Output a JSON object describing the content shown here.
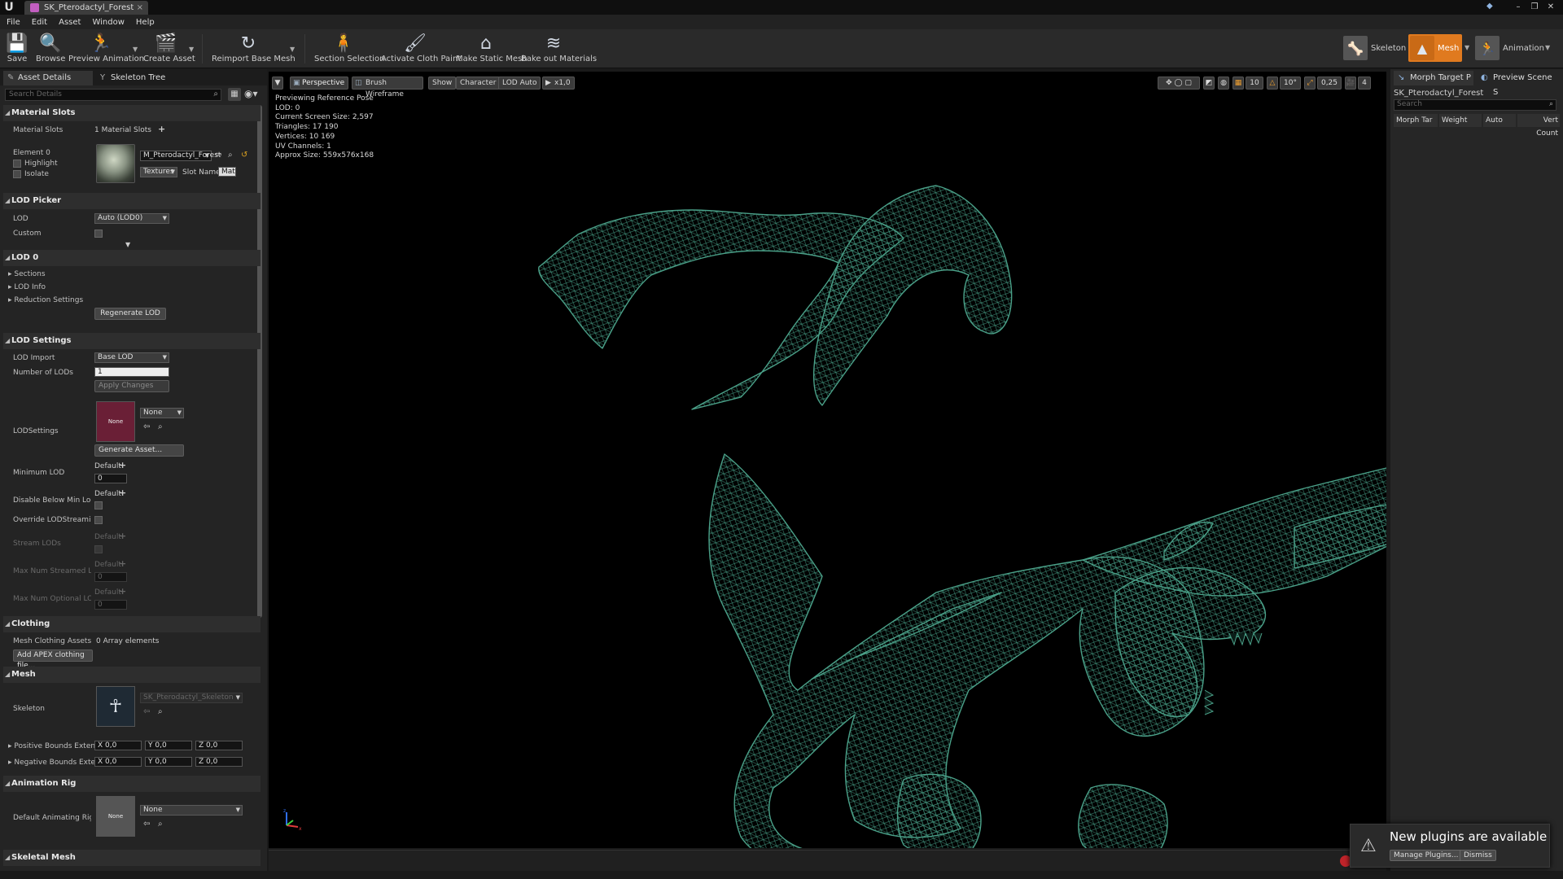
{
  "window": {
    "tab_title": "SK_Pterodactyl_Forest",
    "tab_close": "×",
    "logo": "U",
    "minimize": "–",
    "restore": "❐",
    "close": "✕"
  },
  "menu": [
    "File",
    "Edit",
    "Asset",
    "Window",
    "Help"
  ],
  "toolbar": {
    "save": "Save",
    "browse": "Browse",
    "preview_animation": "Preview Animation",
    "create_asset": "Create Asset",
    "reimport": "Reimport Base Mesh",
    "section_selection": "Section Selection",
    "activate_cloth": "Activate Cloth Paint",
    "make_static": "Make Static Mesh",
    "bake_materials": "Bake out Materials",
    "modes": {
      "skeleton": "Skeleton",
      "mesh": "Mesh",
      "animation": "Animation"
    }
  },
  "left_tabs": {
    "asset_details": "Asset Details",
    "skeleton_tree": "Skeleton Tree"
  },
  "search_placeholder": "Search Details",
  "material_slots": {
    "header": "Material Slots",
    "label": "Material Slots",
    "count": "1 Material Slots",
    "element": "Element 0",
    "highlight": "Highlight",
    "isolate": "Isolate",
    "material": "M_Pterodactyl_Forest",
    "textures": "Textures",
    "slot_name_label": "Slot Name",
    "slot_name": "Mat"
  },
  "lod_picker": {
    "header": "LOD Picker",
    "lod_label": "LOD",
    "lod_value": "Auto (LOD0)",
    "custom_label": "Custom"
  },
  "lod0": {
    "header": "LOD 0",
    "sections": "Sections",
    "lod_info": "LOD Info",
    "reduction": "Reduction Settings",
    "regenerate": "Regenerate LOD"
  },
  "lod_settings": {
    "header": "LOD Settings",
    "lod_import": "LOD Import",
    "lod_import_value": "Base LOD",
    "num_lods": "Number of LODs",
    "num_lods_value": "1",
    "apply": "Apply Changes",
    "lodsettings": "LODSettings",
    "none": "None",
    "generate": "Generate Asset...",
    "min_lod": "Minimum LOD",
    "default": "Default",
    "zero": "0",
    "disable_below": "Disable Below Min Lod St",
    "override_streaming": "Override LODStreaming S",
    "stream_lods": "Stream LODs",
    "max_streamed": "Max Num Streamed LOD",
    "max_optional": "Max Num Optional LODs"
  },
  "clothing": {
    "header": "Clothing",
    "mesh_clothing": "Mesh Clothing Assets",
    "array": "0 Array elements",
    "add_apex": "Add APEX clothing file..."
  },
  "mesh": {
    "header": "Mesh",
    "skeleton_label": "Skeleton",
    "skeleton_value": "SK_Pterodactyl_Skeleton",
    "pos_bounds": "Positive Bounds Extensio",
    "neg_bounds": "Negative Bounds Extensi",
    "x": "X",
    "y": "Y",
    "z": "Z",
    "zero": "0,0"
  },
  "anim_rig": {
    "header": "Animation Rig",
    "default_rig": "Default Animating Rig",
    "none": "None"
  },
  "skeletal_mesh_header": "Skeletal Mesh",
  "viewport": {
    "perspective": "Perspective",
    "wireframe": "Brush Wireframe",
    "show": "Show",
    "character": "Character",
    "lod_auto": "LOD Auto",
    "speed": "x1,0",
    "info": [
      "Previewing Reference Pose",
      "LOD: 0",
      "Current Screen Size: 2,597",
      "Triangles: 17 190",
      "Vertices: 10 169",
      "UV Channels: 1",
      "Approx Size: 559x576x168"
    ],
    "right_controls": {
      "grid": "10",
      "rot": "10°",
      "scale": "0,25",
      "cam": "4"
    },
    "wire_color": "#3f8f79"
  },
  "right_panel": {
    "tab_morph": "Morph Target P",
    "tab_preview": "Preview Scene S",
    "asset": "SK_Pterodactyl_Forest",
    "search": "Search",
    "cols": [
      "Morph Tar",
      "Weight",
      "Auto",
      "Vert Count"
    ]
  },
  "toast": {
    "message": "New plugins are available",
    "manage": "Manage Plugins...",
    "dismiss": "Dismiss"
  }
}
